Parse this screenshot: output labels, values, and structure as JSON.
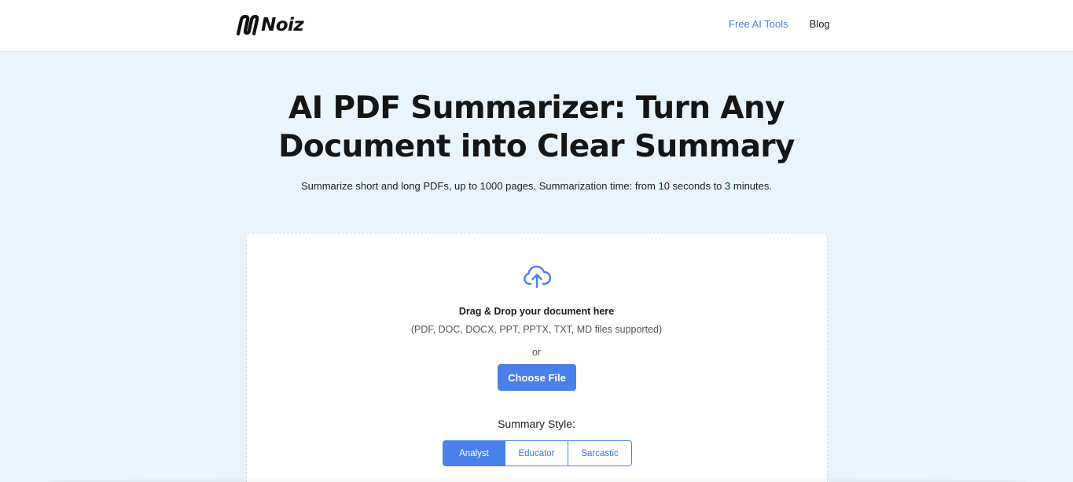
{
  "header": {
    "logo_text": "Noiz",
    "nav": {
      "free_ai_tools": "Free AI Tools",
      "blog": "Blog"
    }
  },
  "hero": {
    "title_line1": "AI PDF Summarizer: Turn Any",
    "title_line2": "Document into Clear Summary",
    "subtitle": "Summarize short and long PDFs, up to 1000 pages. Summarization time: from 10 seconds to 3 minutes."
  },
  "upload": {
    "icon": "cloud-upload-icon",
    "drag_title": "Drag & Drop your document here",
    "formats": "(PDF, DOC, DOCX, PPT, PPTX, TXT, MD files supported)",
    "or": "or",
    "choose_file": "Choose File"
  },
  "summary_style": {
    "label": "Summary Style:",
    "options": [
      "Analyst",
      "Educator",
      "Sarcastic"
    ],
    "selected": "Analyst"
  },
  "colors": {
    "accent": "#4a80ea",
    "page_bg": "#eaf4fd",
    "nav_link": "#4a7fe0"
  }
}
